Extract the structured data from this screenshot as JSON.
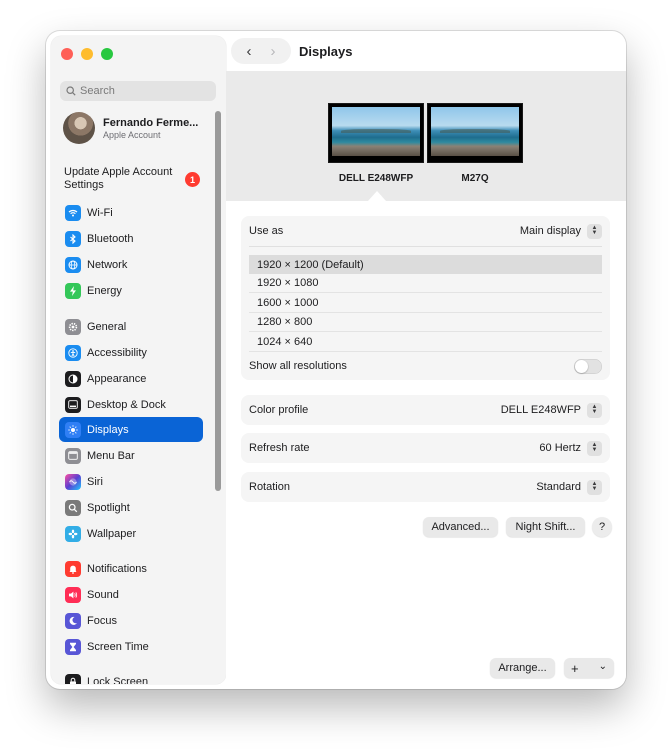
{
  "sidebar": {
    "search_placeholder": "Search",
    "account": {
      "name": "Fernando Ferme...",
      "subtitle": "Apple Account"
    },
    "update": {
      "label": "Update Apple Account Settings",
      "badge": "1"
    },
    "items": [
      {
        "id": "wifi",
        "label": "Wi-Fi",
        "color": "#1a8cf0",
        "icon": "wifi-icon"
      },
      {
        "id": "bluetooth",
        "label": "Bluetooth",
        "color": "#1a8cf0",
        "icon": "bluetooth-icon"
      },
      {
        "id": "network",
        "label": "Network",
        "color": "#1a8cf0",
        "icon": "globe-icon"
      },
      {
        "id": "energy",
        "label": "Energy",
        "color": "#34c759",
        "icon": "bolt-icon"
      },
      {
        "id": "general",
        "label": "General",
        "color": "#8e8e93",
        "icon": "gear-icon"
      },
      {
        "id": "accessibility",
        "label": "Accessibility",
        "color": "#1a8cf0",
        "icon": "accessibility-icon"
      },
      {
        "id": "appearance",
        "label": "Appearance",
        "color": "#1c1c1e",
        "icon": "appearance-icon"
      },
      {
        "id": "desktop-dock",
        "label": "Desktop & Dock",
        "color": "#1c1c1e",
        "icon": "dock-icon"
      },
      {
        "id": "displays",
        "label": "Displays",
        "color": "#2f7ff5",
        "icon": "sun-icon",
        "active": true
      },
      {
        "id": "menu-bar",
        "label": "Menu Bar",
        "color": "#8e8e93",
        "icon": "menubar-icon"
      },
      {
        "id": "siri",
        "label": "Siri",
        "color": "#5b3fd1",
        "icon": "siri-icon"
      },
      {
        "id": "spotlight",
        "label": "Spotlight",
        "color": "#7a7a7a",
        "icon": "magnifier-icon"
      },
      {
        "id": "wallpaper",
        "label": "Wallpaper",
        "color": "#32ade6",
        "icon": "flower-icon"
      },
      {
        "id": "notifications",
        "label": "Notifications",
        "color": "#ff3b30",
        "icon": "bell-icon"
      },
      {
        "id": "sound",
        "label": "Sound",
        "color": "#ff2d55",
        "icon": "speaker-icon"
      },
      {
        "id": "focus",
        "label": "Focus",
        "color": "#5856d6",
        "icon": "moon-icon"
      },
      {
        "id": "screen-time",
        "label": "Screen Time",
        "color": "#5856d6",
        "icon": "hourglass-icon"
      },
      {
        "id": "lock-screen",
        "label": "Lock Screen",
        "color": "#1c1c1e",
        "icon": "lock-icon"
      }
    ]
  },
  "header": {
    "title": "Displays",
    "back": "‹",
    "forward": "›"
  },
  "monitors": [
    {
      "label": "DELL E248WFP",
      "selected": true
    },
    {
      "label": "M27Q",
      "selected": false
    }
  ],
  "use_as": {
    "label": "Use as",
    "value": "Main display"
  },
  "resolutions": [
    "1920 × 1200 (Default)",
    "1920 × 1080",
    "1600 × 1000",
    "1280 × 800",
    "1024 × 640"
  ],
  "selected_resolution": "1920 × 1200 (Default)",
  "show_all": {
    "label": "Show all resolutions",
    "on": false
  },
  "color_profile": {
    "label": "Color profile",
    "value": "DELL E248WFP"
  },
  "refresh_rate": {
    "label": "Refresh rate",
    "value": "60 Hertz"
  },
  "rotation": {
    "label": "Rotation",
    "value": "Standard"
  },
  "buttons": {
    "advanced": "Advanced...",
    "night_shift": "Night Shift...",
    "help": "?",
    "arrange": "Arrange...",
    "add": "+",
    "add_menu": "⌄"
  },
  "colors": {
    "accent": "#0a64d6",
    "close": "#ff5f57",
    "minimize": "#febc2e",
    "zoom": "#28c840"
  }
}
